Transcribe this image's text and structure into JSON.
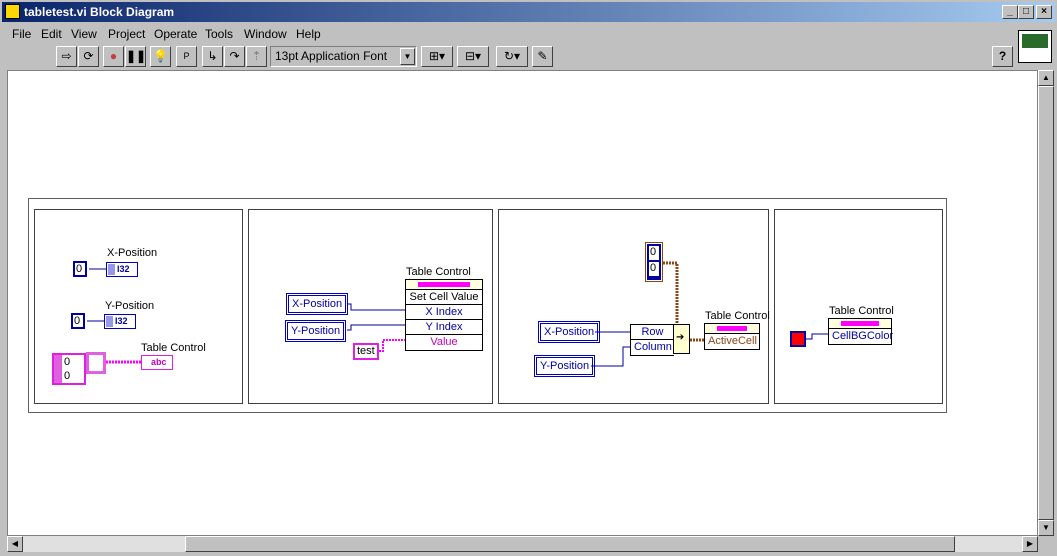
{
  "window": {
    "title": "tabletest.vi Block Diagram",
    "buttons": [
      "_",
      "□",
      "×"
    ]
  },
  "menu": [
    "File",
    "Edit",
    "View",
    "Project",
    "Operate",
    "Tools",
    "Window",
    "Help"
  ],
  "toolbar": {
    "font": "13pt Application Font",
    "help": "?"
  },
  "frames": [
    {
      "x_label": "X-Position",
      "y_label": "Y-Position",
      "x_const": "0",
      "y_const": "0",
      "i32": "I32",
      "table_label": "Table Control",
      "array_values": [
        "0",
        "0"
      ],
      "abc": "abc"
    },
    {
      "x_local": "X-Position",
      "y_local": "Y-Position",
      "string_const": "test",
      "node_label": "Table Control",
      "method": "Set Cell Value",
      "params": [
        "X Index",
        "Y Index",
        "Value"
      ]
    },
    {
      "x_local": "X-Position",
      "y_local": "Y-Position",
      "cluster_values": [
        "0",
        "0"
      ],
      "bundle": [
        "Row",
        "Column"
      ],
      "node_label": "Table Control",
      "prop": "ActiveCell"
    },
    {
      "node_label": "Table Control",
      "prop": "CellBGColor",
      "color": "#ff0000"
    }
  ],
  "colors": {
    "titlebar": "#0a246a",
    "numeric": "#0000c0",
    "string": "#ff00ff",
    "cluster": "#8b4513"
  }
}
